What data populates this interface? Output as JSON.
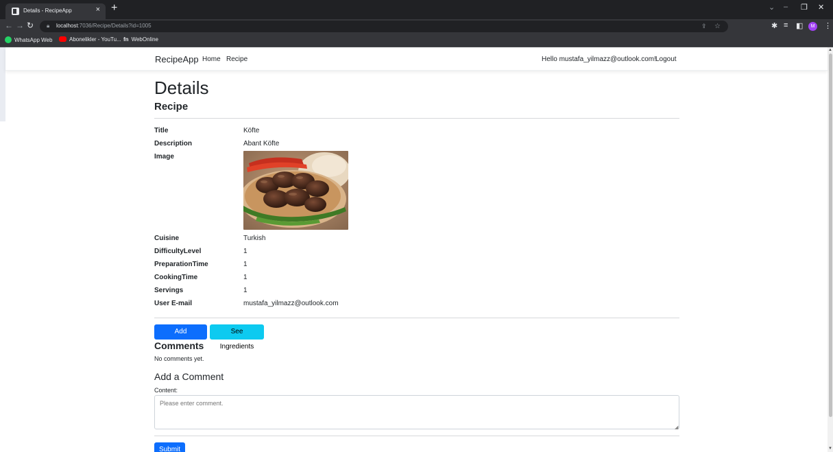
{
  "browser": {
    "tab_title": "Details - RecipeApp",
    "tab_close": "×",
    "new_tab": "+",
    "url_host": "localhost",
    "url_path": ":7036/Recipe/Details?id=1005",
    "bookmarks": [
      {
        "label": "WhatsApp Web",
        "icon": "whatsapp-icon",
        "color": "#25d366"
      },
      {
        "label": "Abonelikler - YouTu...",
        "icon": "youtube-icon",
        "color": "#ff0000"
      },
      {
        "label": "WebOnline",
        "icon": "webonline-icon",
        "color": "#e8eaed"
      }
    ],
    "profile_initial": "M"
  },
  "navbar": {
    "brand": "RecipeApp",
    "links": [
      "Home",
      "Recipe"
    ],
    "greeting": "Hello mustafa_yilmazz@outlook.com!",
    "logout": "Logout"
  },
  "page": {
    "title": "Details",
    "subtitle": "Recipe"
  },
  "details": [
    {
      "label": "Title",
      "value": "Köfte"
    },
    {
      "label": "Description",
      "value": "Abant Köfte"
    },
    {
      "label": "Image",
      "value": ""
    },
    {
      "label": "Cuisine",
      "value": "Turkish"
    },
    {
      "label": "DifficultyLevel",
      "value": "1"
    },
    {
      "label": "PreparationTime",
      "value": "1"
    },
    {
      "label": "CookingTime",
      "value": "1"
    },
    {
      "label": "Servings",
      "value": "1"
    },
    {
      "label": "User E-mail",
      "value": "mustafa_yilmazz@outlook.com"
    }
  ],
  "actions": {
    "add_ingredient": "Add Ingredient",
    "see_ingredients": "See Ingredients"
  },
  "comments": {
    "heading": "Comments",
    "empty_text": "No comments yet."
  },
  "comment_form": {
    "heading": "Add a Comment",
    "content_label": "Content:",
    "placeholder": "Please enter comment.",
    "submit": "Submit"
  },
  "colors": {
    "primary": "#0d6efd",
    "info": "#0dcaf0",
    "chrome_dark": "#202124",
    "chrome_toolbar": "#35363a"
  }
}
